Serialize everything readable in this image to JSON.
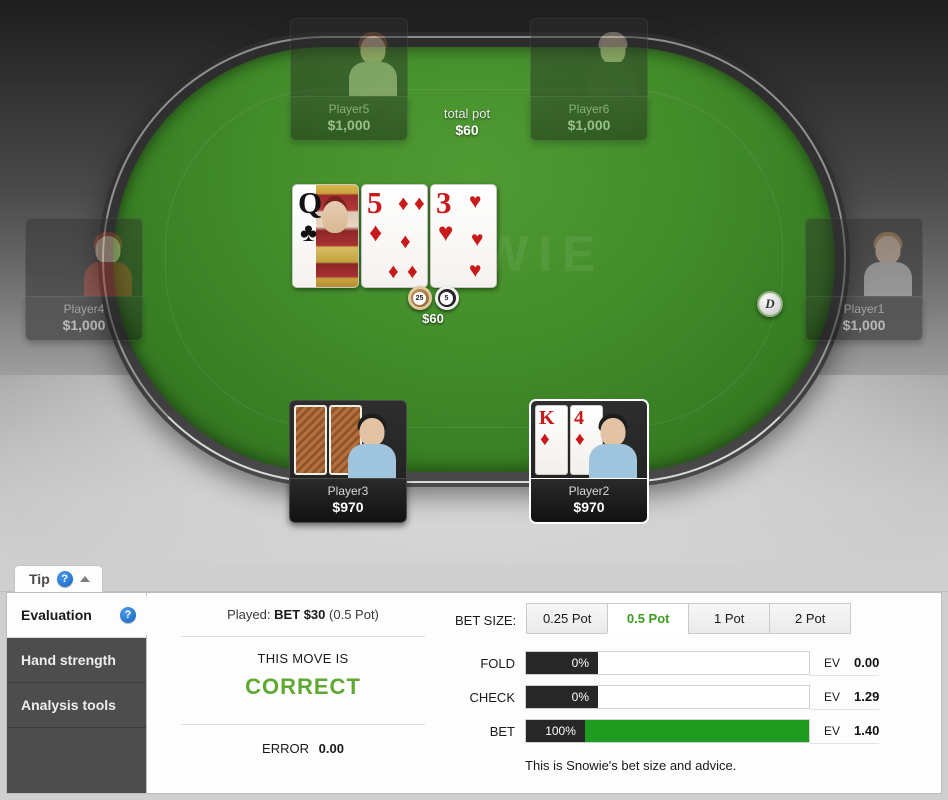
{
  "table": {
    "watermark": "SNOWIE",
    "total_pot_label": "total pot",
    "total_pot_amount": "$60",
    "pot_chips_amount": "$60",
    "dealer_button_label": "D",
    "chips": [
      {
        "denom": "25",
        "name": "chip-25"
      },
      {
        "denom": "5",
        "name": "chip-5"
      }
    ],
    "board_cards": [
      {
        "rank": "Q",
        "suit": "♣",
        "color": "black",
        "face": true
      },
      {
        "rank": "5",
        "suit": "♦",
        "color": "red",
        "face": false
      },
      {
        "rank": "3",
        "suit": "♥",
        "color": "red",
        "face": false
      }
    ],
    "seats": [
      {
        "name": "Player5",
        "stack": "$1,000",
        "state": "folded"
      },
      {
        "name": "Player6",
        "stack": "$1,000",
        "state": "folded"
      },
      {
        "name": "Player4",
        "stack": "$1,000",
        "state": "folded"
      },
      {
        "name": "Player1",
        "stack": "$1,000",
        "state": "folded"
      },
      {
        "name": "Player3",
        "stack": "$970",
        "state": "in-hand"
      },
      {
        "name": "Player2",
        "stack": "$970",
        "state": "active"
      }
    ],
    "hero_cards": [
      {
        "rank": "K",
        "suit": "♦",
        "color": "red"
      },
      {
        "rank": "4",
        "suit": "♦",
        "color": "red"
      }
    ]
  },
  "tip_bar": {
    "label": "Tip",
    "help_icon": "?",
    "collapse_icon": "chevron-up"
  },
  "side_tabs": [
    {
      "label": "Evaluation",
      "active": true,
      "has_help": true
    },
    {
      "label": "Hand strength",
      "active": false,
      "has_help": false
    },
    {
      "label": "Analysis tools",
      "active": false,
      "has_help": false
    }
  ],
  "evaluation": {
    "played_prefix": "Played:",
    "played_action": "BET $30",
    "played_suffix": "(0.5 Pot)",
    "move_label": "THIS MOVE IS",
    "move_verdict": "CORRECT",
    "verdict_color": "#5fa832",
    "error_label": "ERROR",
    "error_value": "0.00"
  },
  "advice": {
    "betsize_label": "BET SIZE:",
    "betsize_tabs": [
      {
        "label": "0.25 Pot",
        "active": false
      },
      {
        "label": "0.5 Pot",
        "active": true
      },
      {
        "label": "1 Pot",
        "active": false
      },
      {
        "label": "2 Pot",
        "active": false
      }
    ],
    "actions": [
      {
        "name": "FOLD",
        "pct_label": "0%",
        "pct": 0,
        "ev_label": "EV",
        "ev": "0.00"
      },
      {
        "name": "CHECK",
        "pct_label": "0%",
        "pct": 0,
        "ev_label": "EV",
        "ev": "1.29"
      },
      {
        "name": "BET",
        "pct_label": "100%",
        "pct": 100,
        "ev_label": "EV",
        "ev": "1.40"
      }
    ],
    "note": "This is Snowie's bet size and advice."
  }
}
